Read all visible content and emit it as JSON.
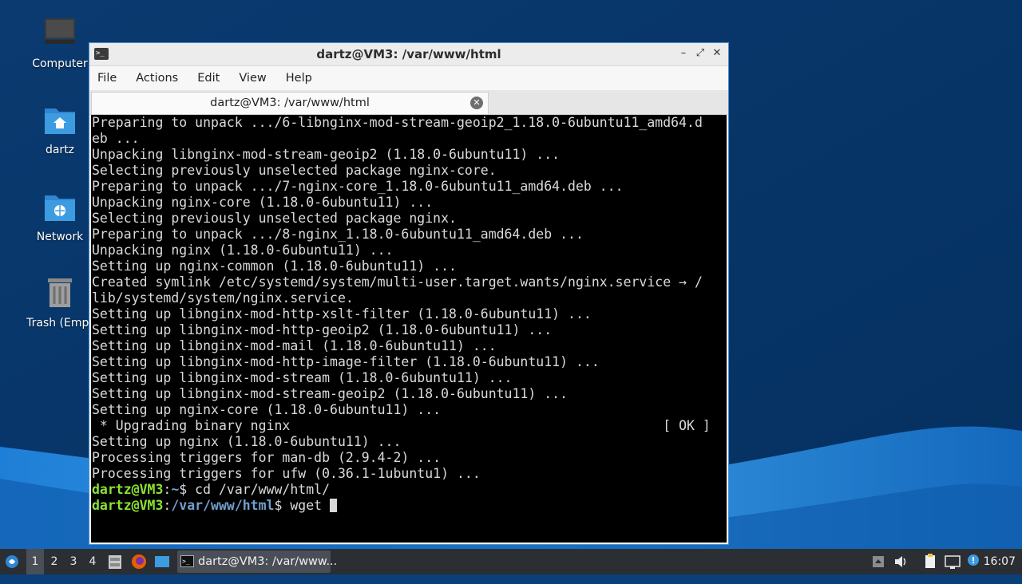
{
  "desktop": {
    "icons": [
      {
        "label": "Computer",
        "icon": "computer-icon"
      },
      {
        "label": "dartz",
        "icon": "home-folder-icon"
      },
      {
        "label": "Network",
        "icon": "network-folder-icon"
      },
      {
        "label": "Trash (Empt",
        "icon": "trash-icon"
      }
    ],
    "wallpaper_colors": {
      "dark": "#063366",
      "mid": "#0c5aa6",
      "light": "#3b9ee8"
    }
  },
  "window": {
    "title": "dartz@VM3: /var/www/html",
    "controls": {
      "minimize": "–",
      "maximize": "⤢",
      "close": "✕"
    },
    "menu": [
      "File",
      "Actions",
      "Edit",
      "View",
      "Help"
    ],
    "tab": {
      "title": "dartz@VM3: /var/www/html"
    }
  },
  "terminal": {
    "lines": [
      "Preparing to unpack .../6-libnginx-mod-stream-geoip2_1.18.0-6ubuntu11_amd64.d",
      "eb ...",
      "Unpacking libnginx-mod-stream-geoip2 (1.18.0-6ubuntu11) ...",
      "Selecting previously unselected package nginx-core.",
      "Preparing to unpack .../7-nginx-core_1.18.0-6ubuntu11_amd64.deb ...",
      "Unpacking nginx-core (1.18.0-6ubuntu11) ...",
      "Selecting previously unselected package nginx.",
      "Preparing to unpack .../8-nginx_1.18.0-6ubuntu11_amd64.deb ...",
      "Unpacking nginx (1.18.0-6ubuntu11) ...",
      "Setting up nginx-common (1.18.0-6ubuntu11) ...",
      "Created symlink /etc/systemd/system/multi-user.target.wants/nginx.service → /",
      "lib/systemd/system/nginx.service.",
      "Setting up libnginx-mod-http-xslt-filter (1.18.0-6ubuntu11) ...",
      "Setting up libnginx-mod-http-geoip2 (1.18.0-6ubuntu11) ...",
      "Setting up libnginx-mod-mail (1.18.0-6ubuntu11) ...",
      "Setting up libnginx-mod-http-image-filter (1.18.0-6ubuntu11) ...",
      "Setting up libnginx-mod-stream (1.18.0-6ubuntu11) ...",
      "Setting up libnginx-mod-stream-geoip2 (1.18.0-6ubuntu11) ...",
      "Setting up nginx-core (1.18.0-6ubuntu11) ...",
      " * Upgrading binary nginx                                               [ OK ]",
      "Setting up nginx (1.18.0-6ubuntu11) ...",
      "Processing triggers for man-db (2.9.4-2) ...",
      "Processing triggers for ufw (0.36.1-1ubuntu1) ..."
    ],
    "prompts": [
      {
        "user": "dartz@VM3",
        "sep": ":",
        "path": "~",
        "symbol": "$ ",
        "command": "cd /var/www/html/"
      },
      {
        "user": "dartz@VM3",
        "sep": ":",
        "path": "/var/www/html",
        "symbol": "$ ",
        "command": "wget "
      }
    ]
  },
  "taskbar": {
    "workspaces": [
      "1",
      "2",
      "3",
      "4"
    ],
    "active_workspace": "1",
    "task": {
      "label": "dartz@VM3: /var/www..."
    },
    "clock": "16:07"
  }
}
